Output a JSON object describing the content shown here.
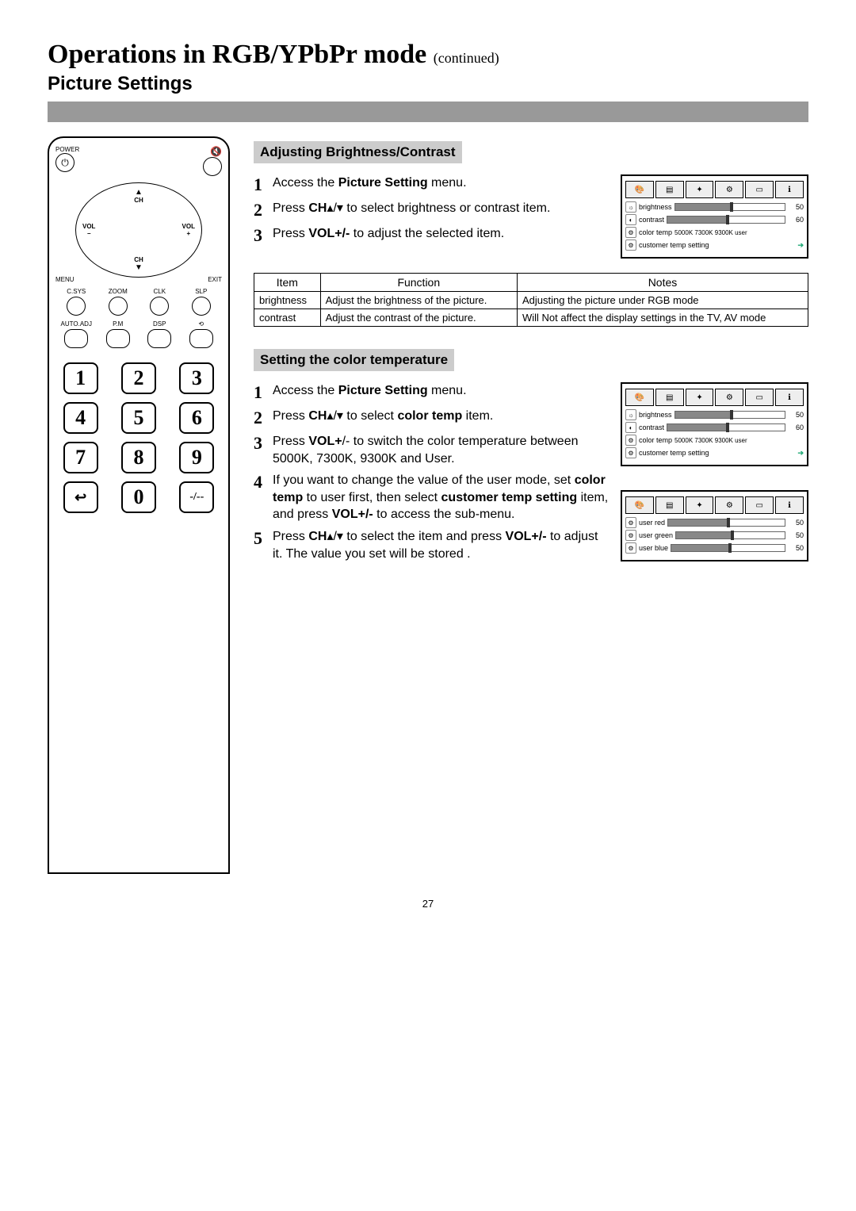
{
  "title_main": "Operations in RGB/YPbPr mode",
  "title_cont": "(continued)",
  "subtitle": "Picture Settings",
  "remote": {
    "power": "POWER",
    "ch": "CH",
    "vol": "VOL",
    "plus": "+",
    "minus": "−",
    "menu": "MENU",
    "exit": "EXIT",
    "row1": [
      "C.SYS",
      "ZOOM",
      "CLK",
      "SLP"
    ],
    "row2": [
      "AUTO.ADJ",
      "P.M",
      "DSP",
      "⟲"
    ],
    "numpad": [
      "1",
      "2",
      "3",
      "4",
      "5",
      "6",
      "7",
      "8",
      "9",
      "↩",
      "0",
      "-/--"
    ]
  },
  "sect1": {
    "heading": "Adjusting Brightness/Contrast",
    "steps": [
      "Access the <b>Picture Setting</b> menu.",
      "Press <b>CH</b>▴/▾ to select brightness or contrast item.",
      "Press <b>VOL+/-</b> to adjust the selected item."
    ],
    "osd": {
      "rows": [
        {
          "icon": "☼",
          "label": "brightness",
          "val": "50",
          "type": "bar"
        },
        {
          "icon": "◐",
          "label": "contrast",
          "val": "60",
          "type": "bar"
        },
        {
          "icon": "⚙",
          "label": "color temp",
          "extra": "5000K  7300K  9300K  user",
          "type": "opts"
        },
        {
          "icon": "⚙",
          "label": "customer temp setting",
          "type": "arrow"
        }
      ]
    },
    "table": {
      "headers": [
        "Item",
        "Function",
        "Notes"
      ],
      "rows": [
        [
          "brightness",
          "Adjust the brightness of the picture.",
          "Adjusting the picture under RGB mode"
        ],
        [
          "contrast",
          "Adjust the contrast of the picture.",
          "Will Not affect the display settings in the TV, AV mode"
        ]
      ]
    }
  },
  "sect2": {
    "heading": "Setting the color temperature",
    "steps": [
      "Access the <b>Picture Setting</b> menu.",
      "Press <b>CH</b>▴/▾  to select <b>color temp</b> item.",
      "Press <b>VOL+</b>/- to switch the color temperature between 5000K, 7300K, 9300K and User.",
      "If you want to change the value of the user mode, set <b>color temp</b> to user first, then select <b>customer temp setting</b> item, and press <b>VOL+/-</b> to access the sub-menu.",
      "Press <b>CH</b>▴/▾  to select the item and press <b>VOL+/-</b> to adjust it. The value you set will be stored ."
    ],
    "osd1": {
      "rows": [
        {
          "icon": "☼",
          "label": "brightness",
          "val": "50",
          "type": "bar"
        },
        {
          "icon": "◐",
          "label": "contrast",
          "val": "60",
          "type": "bar"
        },
        {
          "icon": "⚙",
          "label": "color temp",
          "extra": "5000K  7300K  9300K  user",
          "type": "opts"
        },
        {
          "icon": "⚙",
          "label": "customer temp setting",
          "type": "arrow"
        }
      ]
    },
    "osd2": {
      "rows": [
        {
          "icon": "⚙",
          "label": "user red",
          "val": "50",
          "type": "bar"
        },
        {
          "icon": "⚙",
          "label": "user green",
          "val": "50",
          "type": "bar"
        },
        {
          "icon": "⚙",
          "label": "user blue",
          "val": "50",
          "type": "bar"
        }
      ]
    }
  },
  "page_number": "27"
}
